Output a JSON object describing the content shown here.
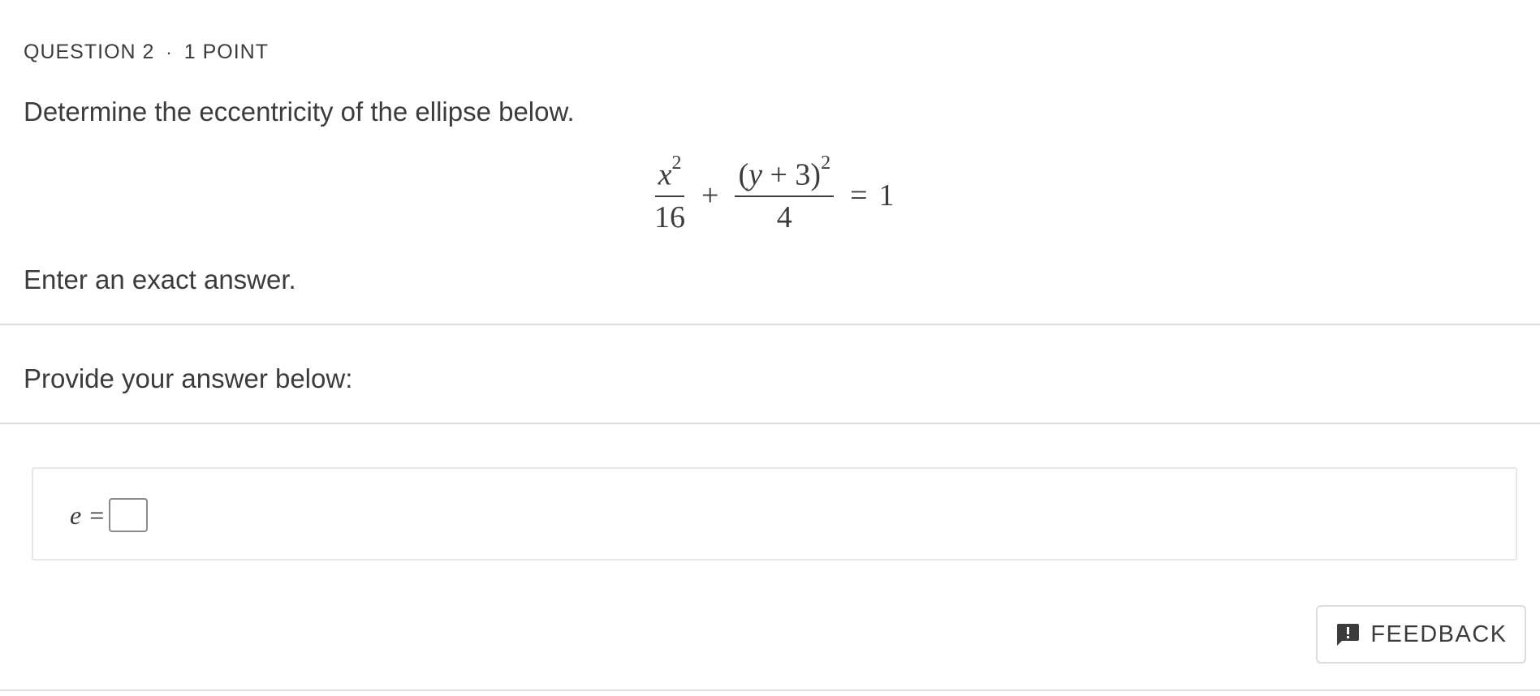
{
  "question": {
    "number_label": "QUESTION 2",
    "separator": "·",
    "points_label": "1 POINT",
    "prompt": "Determine the eccentricity of the ellipse below.",
    "instruction": "Enter an exact answer."
  },
  "equation": {
    "term1_num_var": "x",
    "term1_num_exp": "2",
    "term1_den": "16",
    "plus": "+",
    "term2_num_open": "(",
    "term2_num_var": "y",
    "term2_num_rest": " + 3)",
    "term2_num_exp": "2",
    "term2_den": "4",
    "equals": "=",
    "rhs": "1"
  },
  "answer": {
    "section_label": "Provide your answer below:",
    "variable": "e",
    "equals": "=",
    "value": ""
  },
  "feedback": {
    "label": "FEEDBACK",
    "icon": "feedback-icon"
  }
}
